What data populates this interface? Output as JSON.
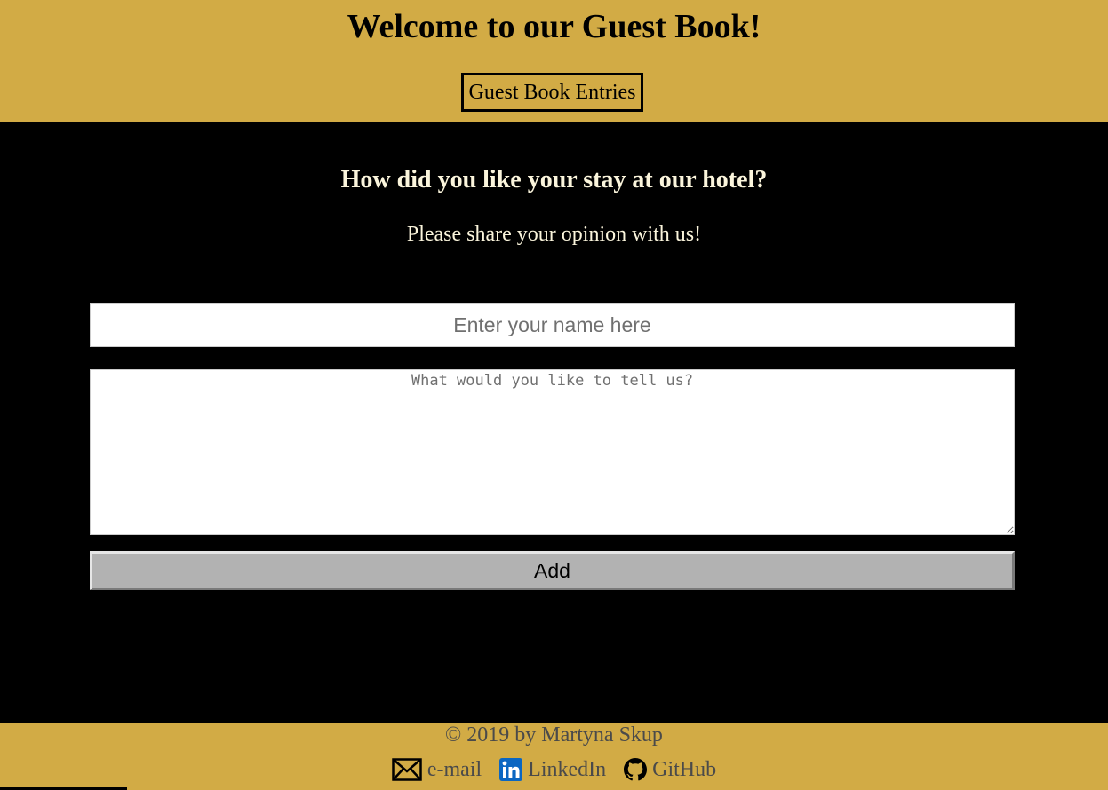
{
  "header": {
    "title": "Welcome to our Guest Book!",
    "entries_button": "Guest Book Entries"
  },
  "main": {
    "heading": "How did you like your stay at our hotel?",
    "subtitle": "Please share your opinion with us!",
    "name_input": {
      "placeholder": "Enter your name here",
      "value": ""
    },
    "message_input": {
      "placeholder": "What would you like to tell us?",
      "value": ""
    },
    "add_button": "Add"
  },
  "footer": {
    "copyright": "© 2019 by Martyna Skup",
    "links": [
      {
        "label": "e-mail",
        "icon": "envelope-icon"
      },
      {
        "label": "LinkedIn",
        "icon": "linkedin-icon"
      },
      {
        "label": "GitHub",
        "icon": "github-icon"
      }
    ]
  },
  "colors": {
    "gold": "#d2ab45",
    "background": "#000000",
    "heading_text": "#fbf5dc",
    "footer_text": "#4a4a4a",
    "button_gray": "#b2b2b2",
    "linkedin_blue": "#0a66c2"
  }
}
